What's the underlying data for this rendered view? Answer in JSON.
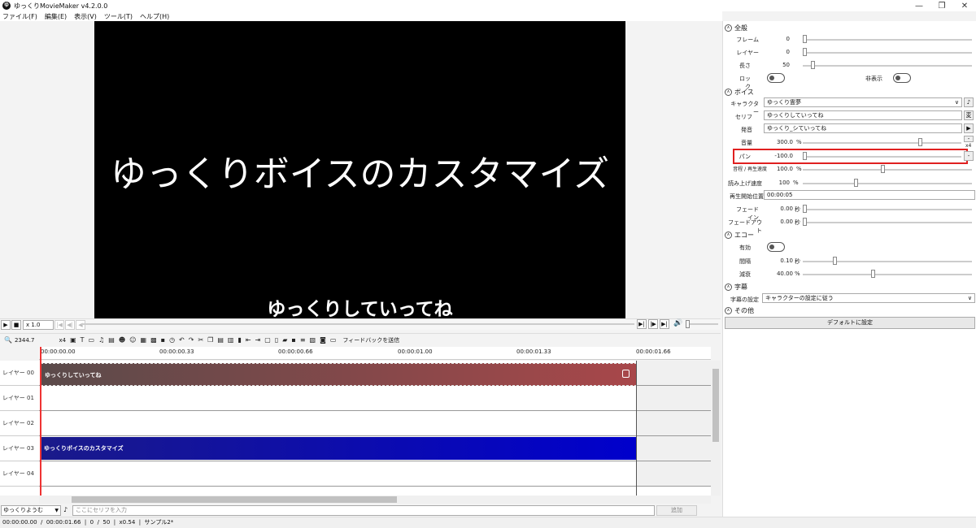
{
  "app": {
    "title": "ゆっくりMovieMaker v4.2.0.0",
    "icon": "app-logo-icon"
  },
  "menu": [
    "ファイル(F)",
    "編集(E)",
    "表示(V)",
    "ツール(T)",
    "ヘルプ(H)"
  ],
  "preview": {
    "main_text": "ゆっくりボイスのカスタマイズ",
    "subtitle": "ゆっくりしていってね"
  },
  "playback": {
    "speed": "x 1.0"
  },
  "toolbar": {
    "zoom": "2344.7",
    "zoom_mult": "x4",
    "feedback": "フィードバックを送信"
  },
  "ruler": [
    "00:00:00.00",
    "00:00:00.33",
    "00:00:00.66",
    "00:00:01.00",
    "00:00:01.33",
    "00:00:01.66"
  ],
  "layers": [
    "レイヤー 00",
    "レイヤー 01",
    "レイヤー 02",
    "レイヤー 03",
    "レイヤー 04"
  ],
  "clips": {
    "voice": "ゆっくりしていってね",
    "text": "ゆっくりボイスのカスタマイズ"
  },
  "input": {
    "character": "ゆっくりようむ",
    "placeholder": "ここにセリフを入力",
    "add": "追加"
  },
  "status": "00:00:00.00  /  00:00:01.66  |  0  /  50  |  x0.54  |  サンプル2*",
  "panel": {
    "general": {
      "header": "全般",
      "frame_label": "フレーム",
      "frame": "0",
      "layer_label": "レイヤー",
      "layer": "0",
      "length_label": "長さ",
      "length": "50",
      "lock_label": "ロック",
      "hide_label": "非表示"
    },
    "voice": {
      "header": "ボイス",
      "char_label": "キャラクター",
      "char": "ゆっくり霊夢",
      "serif_label": "セリフ",
      "serif": "ゆっくりしていってね",
      "pron_label": "発音",
      "pron": "ゆっくり_シていってね",
      "volume_label": "音量",
      "volume": "300.0",
      "volume_unit": "%",
      "volume_mult": "x4",
      "pan_label": "パン",
      "pan": "-100.0",
      "speed_label": "音程 / 再生速度",
      "speed": "100.0",
      "speed_unit": "%",
      "read_label": "読み上げ速度",
      "read": "100",
      "read_unit": "%",
      "start_label": "再生開始位置",
      "start": "00:00:05",
      "fadein_label": "フェードイン",
      "fadein": "0.00",
      "fadein_unit": "秒",
      "fadeout_label": "フェードアウト",
      "fadeout": "0.00",
      "fadeout_unit": "秒"
    },
    "echo": {
      "header": "エコー",
      "enabled_label": "有効",
      "interval_label": "間隔",
      "interval": "0.10",
      "interval_unit": "秒",
      "decay_label": "減衰",
      "decay": "40.00",
      "decay_unit": "%"
    },
    "subtitle": {
      "header": "字幕",
      "setting_label": "字幕の設定",
      "setting": "キャラクターの設定に従う"
    },
    "other": {
      "header": "その他"
    },
    "default_button": "デフォルトに設定"
  }
}
